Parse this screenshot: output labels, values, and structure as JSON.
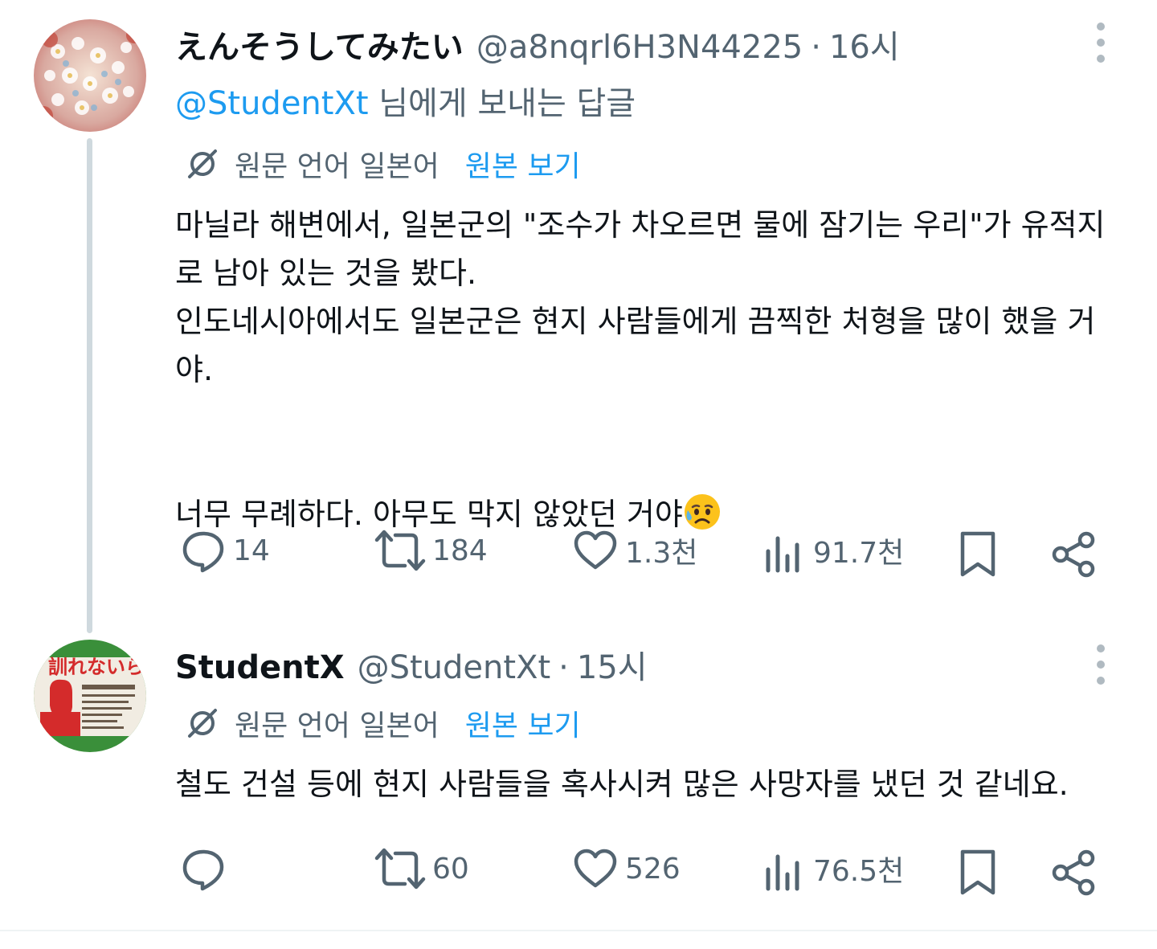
{
  "tweets": [
    {
      "display_name": "えんそうしてみたい",
      "handle": "@a8nqrl6H3N44225",
      "separator": "·",
      "time": "16시",
      "reply_mention": "@StudentXt",
      "reply_rest": " 님에게 보내는 답글",
      "translation_label": "원문 언어 일본어",
      "show_original": "원본 보기",
      "text": "마닐라 해변에서, 일본군의 \"조수가 차오르면 물에 잠기는 우리\"가 유적지로 남아 있는 것을 봤다.\n인도네시아에서도 일본군은 현지 사람들에게 끔찍한 처형을 많이 했을 거야.",
      "text_last": "너무 무례하다. 아무도 막지 않았던 거야",
      "emoji": "sad-but-relieved-face",
      "actions": {
        "replies": "14",
        "reposts": "184",
        "likes": "1.3천",
        "views": "91.7천"
      }
    },
    {
      "display_name": "StudentX",
      "handle": "@StudentXt",
      "separator": "·",
      "time": "15시",
      "translation_label": "원문 언어 일본어",
      "show_original": "원본 보기",
      "text": "철도 건설 등에 현지 사람들을 혹사시켜 많은 사망자를 냈던 것 같네요.",
      "actions": {
        "replies": "",
        "reposts": "60",
        "likes": "526",
        "views": "76.5천"
      }
    }
  ],
  "colors": {
    "accent": "#1d9bf0",
    "secondary_text": "#536471",
    "primary_text": "#0f1419",
    "thread_line": "#cfd9de"
  }
}
